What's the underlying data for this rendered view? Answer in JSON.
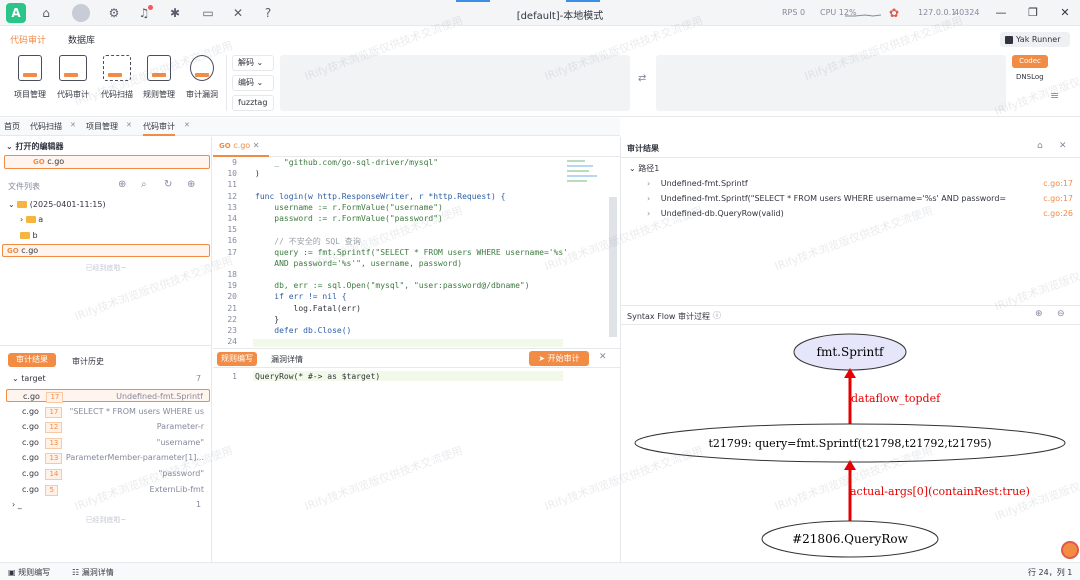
{
  "window": {
    "title": "[default]-本地模式",
    "rps": "RPS 0",
    "cpu": "CPU 12%",
    "ip": "127.0.0.1",
    "port": "40324"
  },
  "menu": {
    "tab_audit": "代码审计",
    "tab_db": "数据库",
    "yak_runner": "Yak Runner"
  },
  "ribbon": {
    "items": [
      "项目管理",
      "代码审计",
      "代码扫描",
      "规则管理",
      "审计漏洞"
    ],
    "decode": "解码",
    "encode": "编码",
    "fuzztag": "fuzztag",
    "codec": "Codec",
    "dnslog": "DNSLog"
  },
  "tabs": [
    "首页",
    "代码扫描",
    "项目管理",
    "代码审计"
  ],
  "left": {
    "open_editors": "打开的编辑器",
    "open_file": "c.go",
    "file_list": "文件列表",
    "tree": {
      "root": "(2025-0401-11:15)",
      "a": "a",
      "b": "b",
      "cgo": "c.go"
    },
    "loaded_all": "已经到底啦~",
    "audit_tab": "审计结果",
    "history_tab": "审计历史",
    "target": "target",
    "target_count": "7",
    "results": [
      {
        "file": "c.go",
        "line": "17",
        "desc": "Undefined-fmt.Sprintf"
      },
      {
        "file": "c.go",
        "line": "17",
        "desc": "\"SELECT * FROM users WHERE us"
      },
      {
        "file": "c.go",
        "line": "12",
        "desc": "Parameter-r"
      },
      {
        "file": "c.go",
        "line": "13",
        "desc": "\"username\""
      },
      {
        "file": "c.go",
        "line": "13",
        "desc": "ParameterMember-parameter[1]..."
      },
      {
        "file": "c.go",
        "line": "14",
        "desc": "\"password\""
      },
      {
        "file": "c.go",
        "line": "5",
        "desc": "ExternLib-fmt"
      }
    ],
    "other": "_",
    "other_count": "1",
    "loaded_all2": "已经到底啦~"
  },
  "editor": {
    "tab": "c.go",
    "lines": [
      {
        "n": "9",
        "t": "    _ \"github.com/go-sql-driver/mysql\""
      },
      {
        "n": "10",
        "t": ")"
      },
      {
        "n": "11",
        "t": ""
      },
      {
        "n": "12",
        "t": "func login(w http.ResponseWriter, r *http.Request) {"
      },
      {
        "n": "13",
        "t": "    username := r.FormValue(\"username\")"
      },
      {
        "n": "14",
        "t": "    password := r.FormValue(\"password\")"
      },
      {
        "n": "15",
        "t": ""
      },
      {
        "n": "16",
        "t": "    // 不安全的 SQL 查询"
      },
      {
        "n": "17",
        "t": "    query := fmt.Sprintf(\"SELECT * FROM users WHERE username='%s'"
      },
      {
        "n": "",
        "t": "    AND password='%s'\", username, password)"
      },
      {
        "n": "18",
        "t": ""
      },
      {
        "n": "19",
        "t": "    db, err := sql.Open(\"mysql\", \"user:password@/dbname\")"
      },
      {
        "n": "20",
        "t": "    if err != nil {"
      },
      {
        "n": "21",
        "t": "        log.Fatal(err)"
      },
      {
        "n": "22",
        "t": "    }"
      },
      {
        "n": "23",
        "t": "    defer db.Close()"
      },
      {
        "n": "24",
        "t": ""
      }
    ]
  },
  "rule": {
    "tab_rule": "规则编写",
    "tab_vuln": "漏洞详情",
    "start": "开始审计",
    "line": "1",
    "code": "QueryRow(* #-> as $target)"
  },
  "result": {
    "title": "审计结果",
    "path": "路径1",
    "items": [
      {
        "text": "Undefined-fmt.Sprintf",
        "loc": "c.go:17"
      },
      {
        "text": "Undefined-fmt.Sprintf(\"SELECT * FROM users WHERE username='%s' AND password='%s'\",P...",
        "loc": "c.go:17"
      },
      {
        "text": "Undefined-db.QueryRow(valid)",
        "loc": "c.go:26"
      }
    ]
  },
  "flow": {
    "title": "Syntax Flow 审计过程",
    "node1": "fmt.Sprintf",
    "edge1": "dataflow_topdef",
    "node2": "t21799: query=fmt.Sprintf(t21798,t21792,t21795)",
    "edge2": "actual-args[0](containRest:true)",
    "node3": "#21806.QueryRow"
  },
  "status": {
    "rule": "规则编写",
    "vuln": "漏洞详情",
    "pos": "行 24，列 1"
  },
  "watermark": "IRify技术浏览版仅供技术交流使用"
}
